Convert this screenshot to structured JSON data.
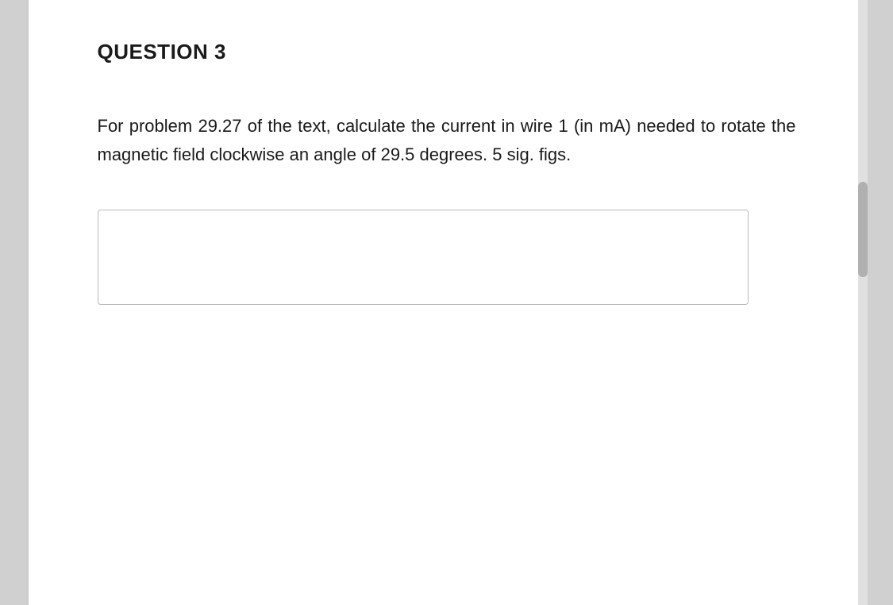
{
  "question": {
    "title": "QUESTION 3",
    "body": "For  problem  29.27  of  the  text,  calculate  the current  in  wire  1  (in  mA)  needed  to  rotate  the magnetic  field  clockwise   an   angle   of   29.5 degrees. 5 sig. figs.",
    "answer_placeholder": ""
  }
}
